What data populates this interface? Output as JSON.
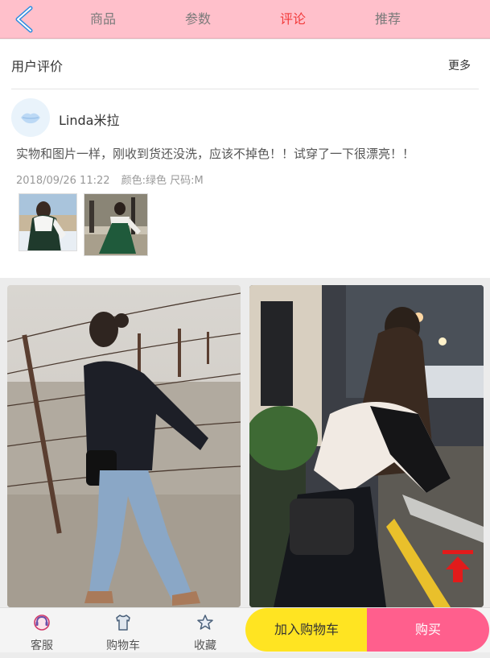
{
  "nav": {
    "tabs": [
      {
        "label": "商品",
        "active": false
      },
      {
        "label": "参数",
        "active": false
      },
      {
        "label": "评论",
        "active": true
      },
      {
        "label": "推荐",
        "active": false
      }
    ],
    "back_icon": "chevron-left-icon"
  },
  "review": {
    "section_title": "用户评价",
    "more_label": "更多",
    "user": {
      "name": "Linda米拉",
      "avatar_icon": "lips-avatar-icon"
    },
    "comment": "实物和图片一样，刚收到货还没洗，应该不掉色！！试穿了一下很漂亮！！",
    "date": "2018/09/26 11:22",
    "color": "颜色:绿色",
    "size": "尺码:M"
  },
  "bottom_bar": {
    "service_label": "客服",
    "cart_label": "购物车",
    "favorite_label": "收藏",
    "add_cart_label": "加入购物车",
    "buy_label": "购买"
  },
  "colors": {
    "topbar": "#ffc0cb",
    "active_tab": "#f23a3a",
    "add_cart": "#ffe422",
    "buy": "#ff5f8d",
    "to_top_arrow": "#e21b1b"
  }
}
